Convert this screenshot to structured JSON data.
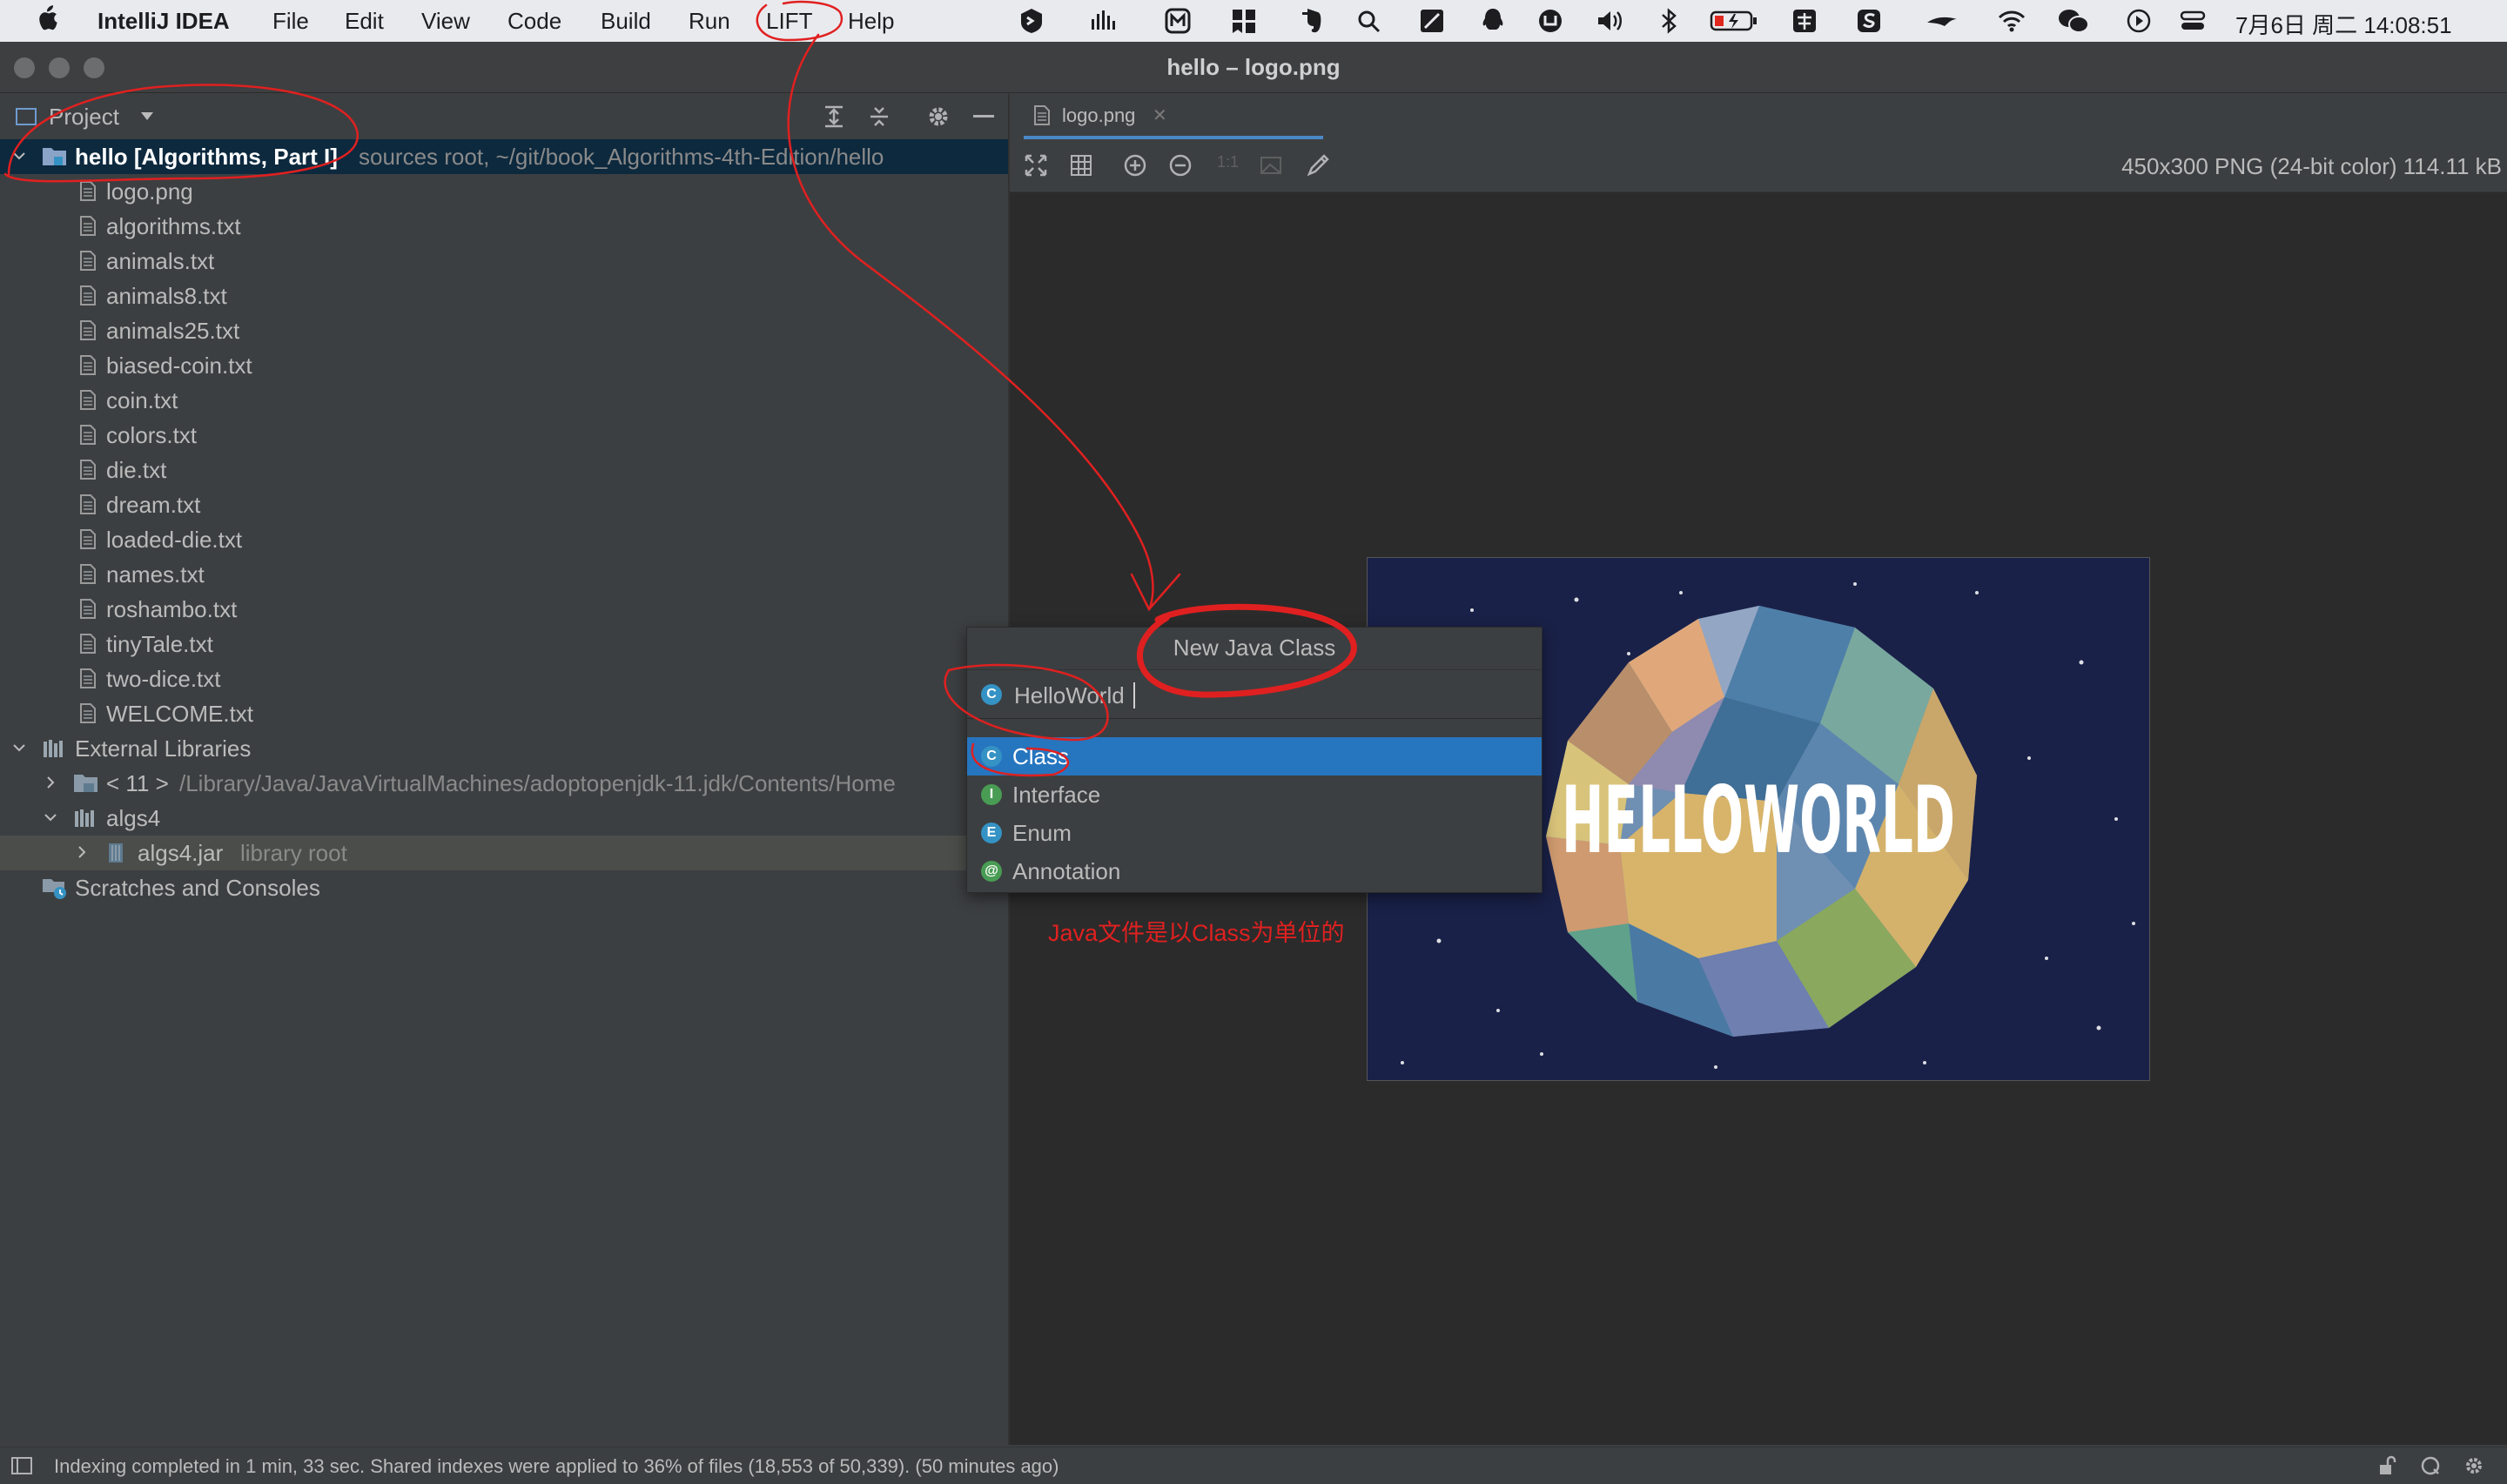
{
  "menubar": {
    "apple_icon": "apple-icon",
    "app_name": "IntelliJ IDEA",
    "items": [
      "File",
      "Edit",
      "View",
      "Code",
      "Build",
      "Run",
      "LIFT",
      "Help"
    ],
    "clock": "7月6日 周二 14:08:51"
  },
  "window": {
    "title": "hello – logo.png"
  },
  "project_panel": {
    "title": "Project",
    "root": {
      "name": "hello [Algorithms, Part I]",
      "hint": "sources root,  ~/git/book_Algorithms-4th-Edition/hello"
    },
    "files": [
      "logo.png",
      "algorithms.txt",
      "animals.txt",
      "animals8.txt",
      "animals25.txt",
      "biased-coin.txt",
      "coin.txt",
      "colors.txt",
      "die.txt",
      "dream.txt",
      "loaded-die.txt",
      "names.txt",
      "roshambo.txt",
      "tinyTale.txt",
      "two-dice.txt",
      "WELCOME.txt"
    ],
    "external_libraries": "External Libraries",
    "jdk": {
      "name": "< 11 >",
      "hint": "/Library/Java/JavaVirtualMachines/adoptopenjdk-11.jdk/Contents/Home"
    },
    "algs4": "algs4",
    "algs4_jar": {
      "name": "algs4.jar",
      "hint": "library root"
    },
    "scratches": "Scratches and Consoles"
  },
  "editor": {
    "tab_label": "logo.png",
    "image_info": "450x300 PNG (24-bit color) 114.11 kB",
    "image_text": "HELLOWORLD",
    "zoom_one_label": "1:1"
  },
  "new_class_popup": {
    "title": "New Java Class",
    "input_value": "HelloWorld",
    "kinds": [
      {
        "label": "Class",
        "icon_letter": "C",
        "color": "#3592c4"
      },
      {
        "label": "Interface",
        "icon_letter": "I",
        "color": "#499c54"
      },
      {
        "label": "Enum",
        "icon_letter": "E",
        "color": "#3592c4"
      },
      {
        "label": "Annotation",
        "icon_letter": "@",
        "color": "#499c54"
      }
    ],
    "selected": "Class"
  },
  "annotation_note": "Java文件是以Class为单位的",
  "statusbar": {
    "text": "Indexing completed in 1 min, 33 sec. Shared indexes were applied to 36% of files (18,553 of 50,339). (50 minutes ago)"
  },
  "colors": {
    "accent": "#2675bf",
    "annotation": "#e02020",
    "background": "#3c3f41",
    "editor": "#2b2b2b"
  }
}
